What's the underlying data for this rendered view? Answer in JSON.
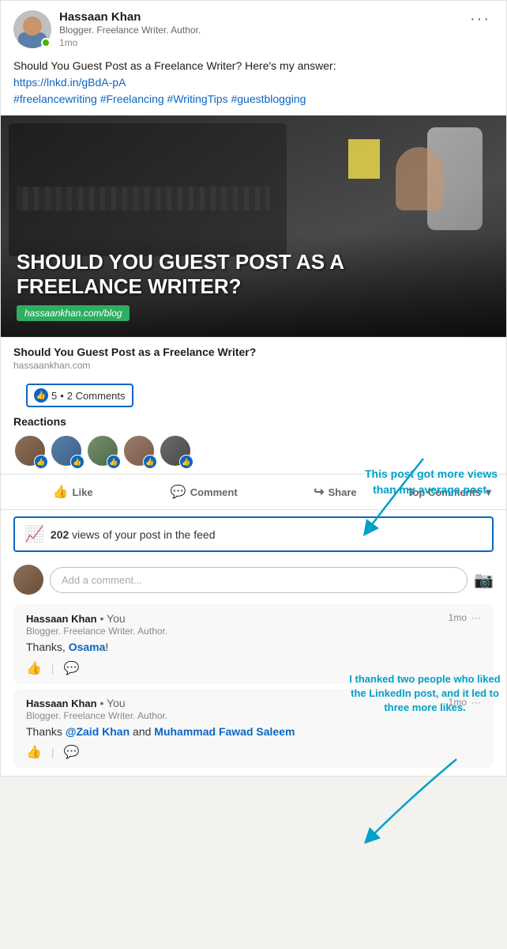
{
  "author": {
    "name": "Hassaan Khan",
    "subtitle": "Blogger. Freelance Writer. Author.",
    "time": "1mo",
    "online": true
  },
  "post": {
    "text_line1": "Should You Guest Post as a Freelance Writer? Here's my answer:",
    "link": "https://lnkd.in/gBdA-pA",
    "hashtags": "#freelancewriting #Freelancing #WritingTips #guestblogging",
    "image_title_line1": "SHOULD YOU GUEST POST AS A",
    "image_title_line2": "FREELANCE WRITER?",
    "image_url": "hassaankhan.com/blog",
    "article_title": "Should You Guest Post as a Freelance Writer?",
    "article_domain": "hassaankhan.com"
  },
  "reactions": {
    "count": "5",
    "comments_label": "2 Comments",
    "label": "Reactions"
  },
  "views": {
    "count": "202",
    "text": "views of your post in the feed",
    "full_text": "202 views of your post in the feed"
  },
  "actions": {
    "like": "Like",
    "comment": "Comment",
    "share": "Share",
    "top_comments": "Top Comments"
  },
  "annotations": {
    "annotation1": "This post got more views than my average post.",
    "annotation2": "I thanked two people who liked the LinkedIn post, and it led to three more likes."
  },
  "comments": [
    {
      "author": "Hassaan Khan",
      "you_label": "• You",
      "meta": "Blogger. Freelance Writer. Author.",
      "time": "1mo",
      "text": "Thanks, ",
      "mention": "Osama",
      "text2": "!"
    },
    {
      "author": "Hassaan Khan",
      "you_label": "• You",
      "meta": "Blogger. Freelance Writer. Author.",
      "time": "1mo",
      "text": "Thanks ",
      "mention1": "@Zaid Khan",
      "between": " and ",
      "mention2": "Muhammad Fawad Saleem"
    }
  ],
  "comment_input": {
    "placeholder": "Add a comment..."
  }
}
